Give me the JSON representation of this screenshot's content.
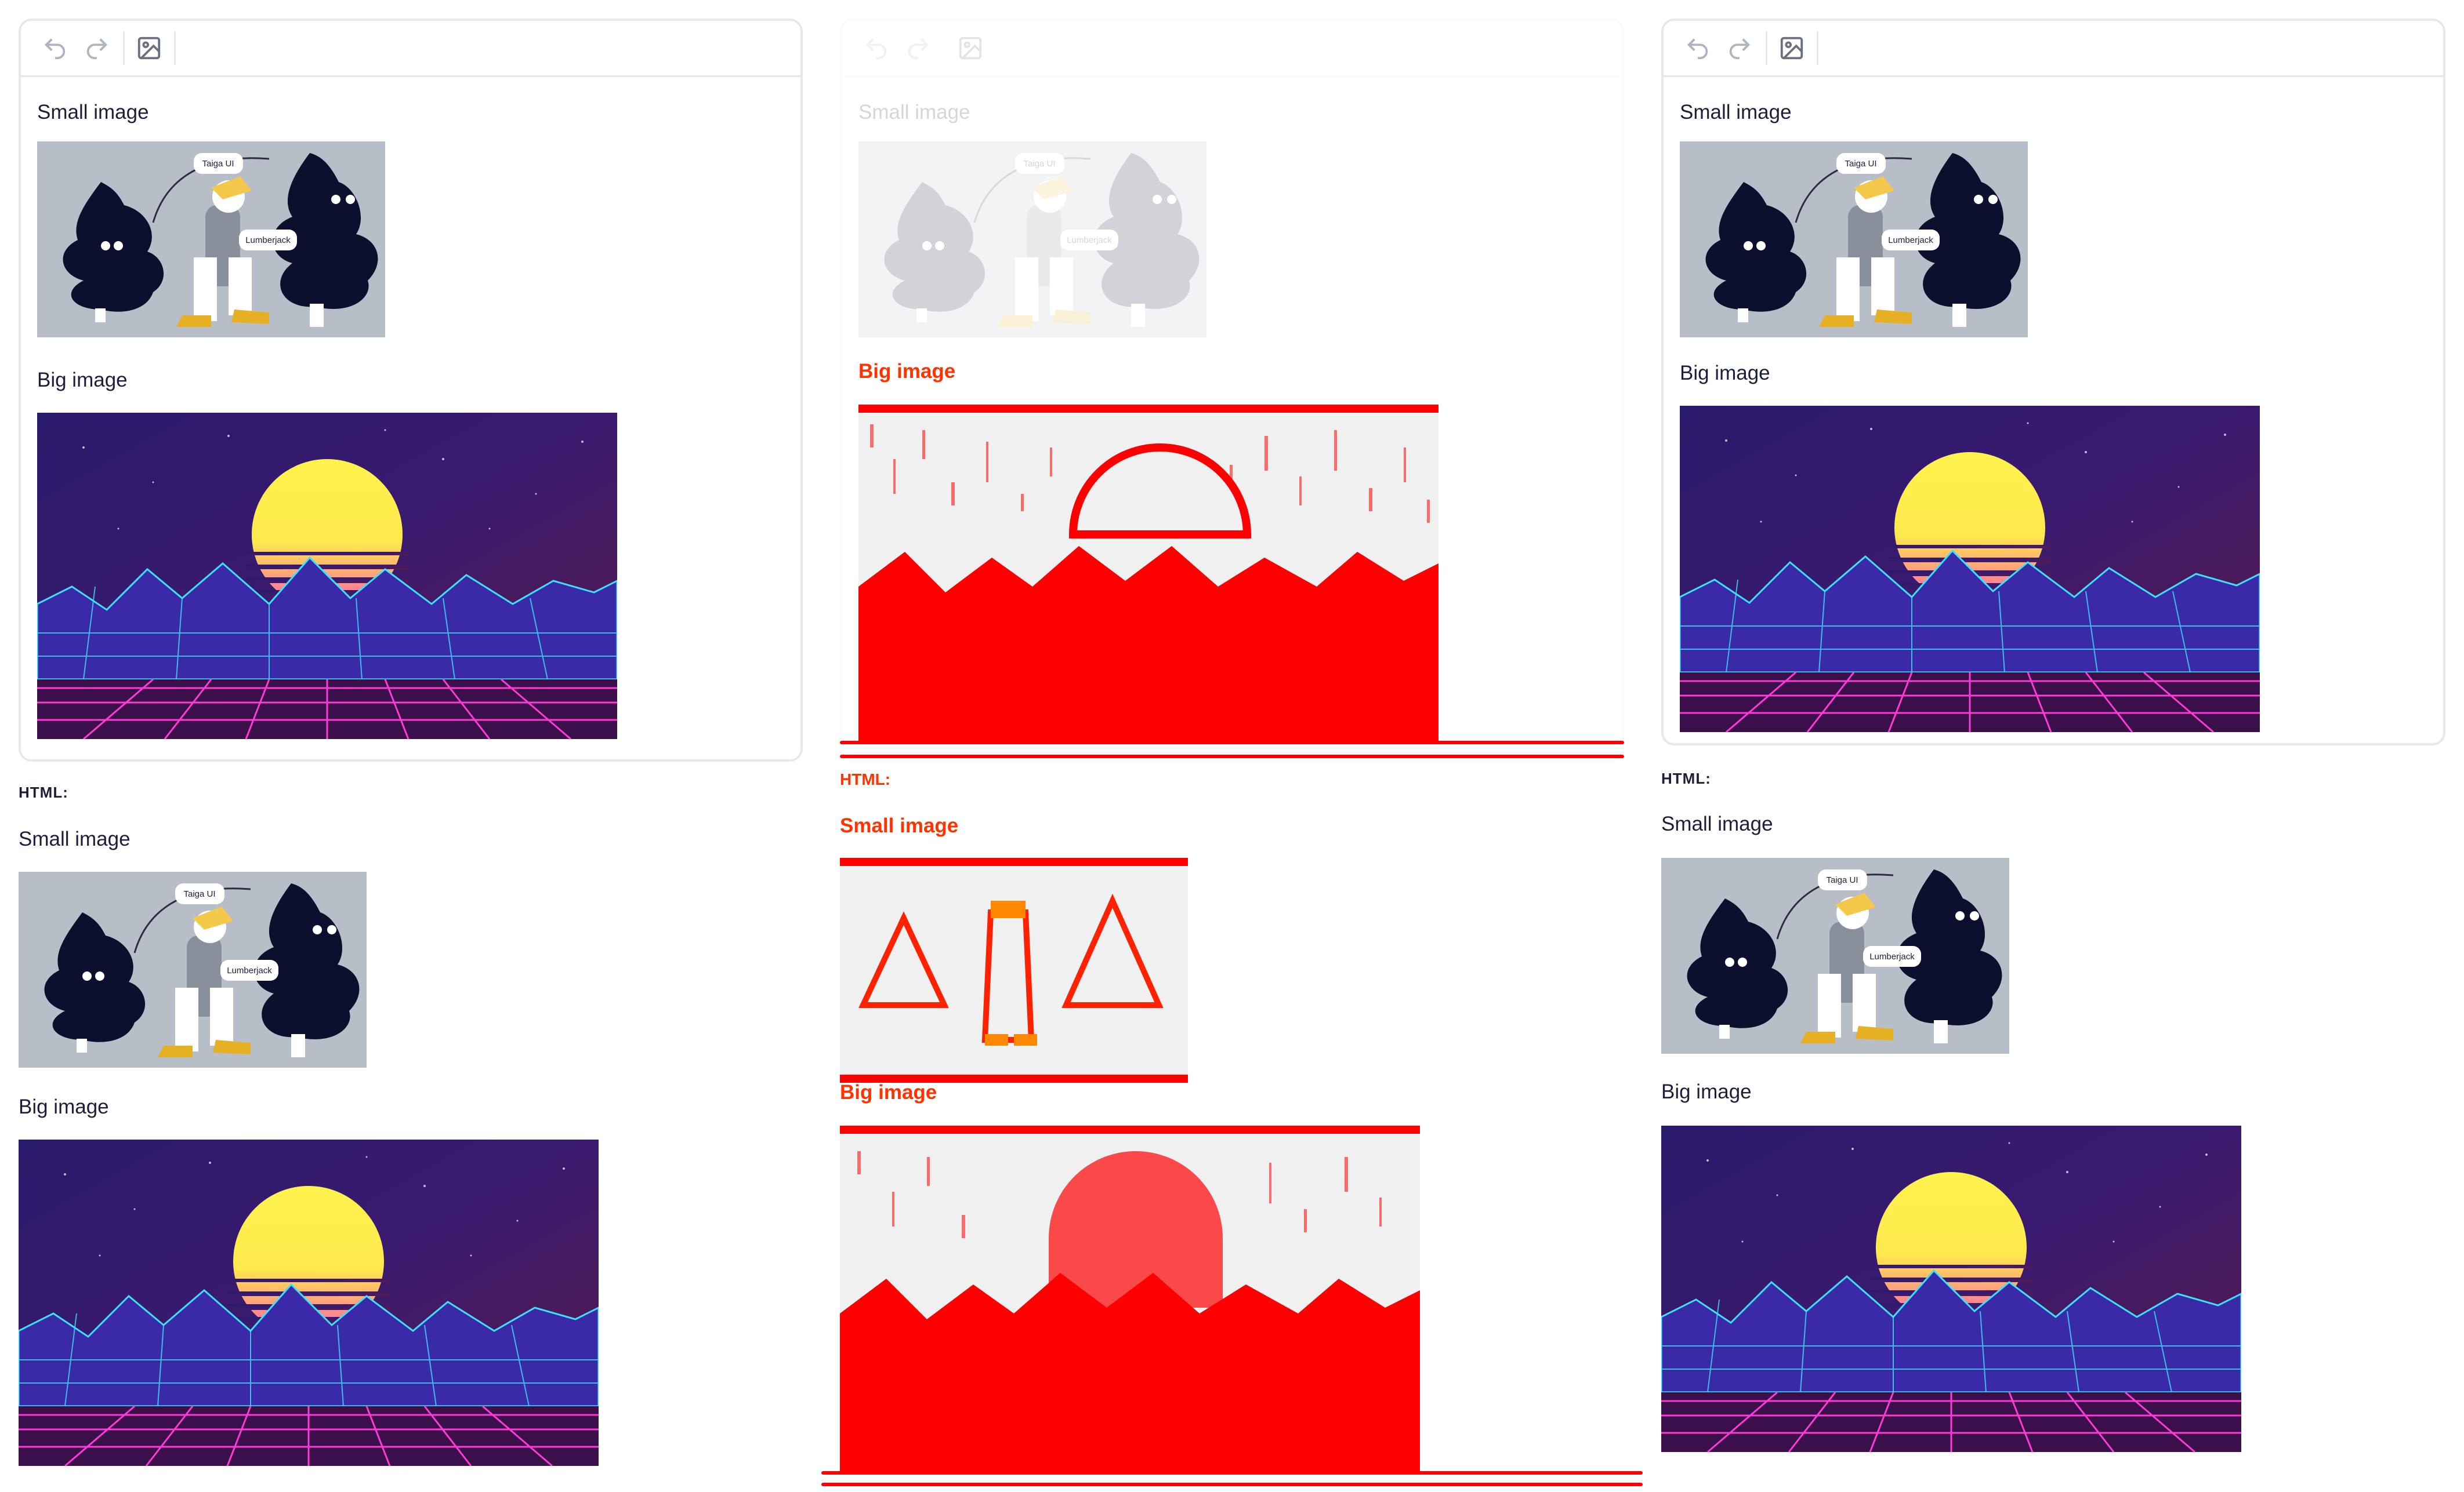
{
  "toolbar": {
    "undo_icon": "undo-icon",
    "redo_icon": "redo-icon",
    "image_icon": "image-icon"
  },
  "editor_content": {
    "small_image_label": "Small image",
    "big_image_label": "Big image"
  },
  "html_section": {
    "heading": "HTML:",
    "small_image_label": "Small image",
    "big_image_label": "Big image"
  },
  "illustration": {
    "tag_one": "Taiga UI",
    "tag_two": "Lumberjack"
  },
  "colors": {
    "border": "#e6e8ee",
    "text": "#1b1f3b",
    "diff_red": "#ff0000",
    "tree_dark": "#0c0f2e",
    "illustration_bg": "#b8bec8",
    "sun_yellow": "#ffe94d"
  }
}
